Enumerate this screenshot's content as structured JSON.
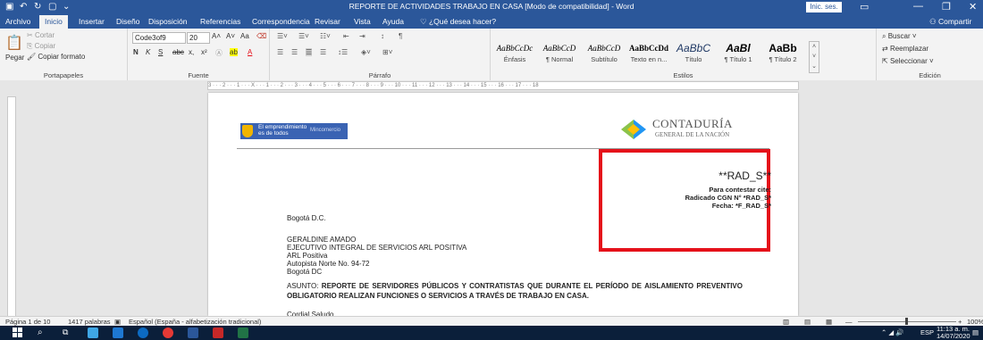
{
  "window": {
    "title": "REPORTE DE ACTIVIDADES TRABAJO EN CASA [Modo de compatibilidad] - Word",
    "sign_in": "Inic. ses."
  },
  "tabs": {
    "items": [
      "Archivo",
      "Inicio",
      "Insertar",
      "Diseño",
      "Disposición",
      "Referencias",
      "Correspondencia",
      "Revisar",
      "Vista",
      "Ayuda"
    ],
    "tell_me": "¿Qué desea hacer?",
    "share": "Compartir"
  },
  "ribbon": {
    "clipboard": {
      "label": "Portapapeles",
      "paste": "Pegar",
      "cut": "Cortar",
      "copy": "Copiar",
      "format_painter": "Copiar formato"
    },
    "font": {
      "label": "Fuente",
      "font_name": "Code3of9",
      "font_size": "20",
      "bold": "N",
      "italic": "K",
      "underline": "S",
      "strike": "abc",
      "sub": "x,",
      "sup": "x²"
    },
    "paragraph": {
      "label": "Párrafo"
    },
    "styles": {
      "label": "Estilos",
      "items": [
        {
          "preview": "AaBbCcDc",
          "name": "Énfasis"
        },
        {
          "preview": "AaBbCcD",
          "name": "¶ Normal"
        },
        {
          "preview": "AaBbCcD",
          "name": "Subtítulo"
        },
        {
          "preview": "AaBbCcDd",
          "name": "Texto en n..."
        },
        {
          "preview": "AaBbC",
          "name": "Título"
        },
        {
          "preview": "AaBl",
          "name": "¶ Título 1"
        },
        {
          "preview": "AaBb",
          "name": "¶ Título 2"
        }
      ]
    },
    "editing": {
      "label": "Edición",
      "find": "Buscar",
      "replace": "Reemplazar",
      "select": "Seleccionar"
    }
  },
  "ruler": {
    "text": "3 · · · 2 · · · 1 · · · X · · · 1 · · · 2 · · · 3 · · · 4 · · · 5 · · · 6 · · · 7 · · · 8 · · · 9 · · · 10 · · · 11 · · · 12 · · · 13 · · · 14 · · · 15 · · · 16 · · · 17 · · · 18"
  },
  "document": {
    "logo_left_line1": "El emprendimiento",
    "logo_left_line2": "es de todos",
    "logo_left_tag": "Mincomercio",
    "logo_right_name": "CONTADURÍA",
    "logo_right_sub": "GENERAL DE LA NACIÓN",
    "rad_main": "**RAD_S**",
    "rad_line1": "Para contestar cite:",
    "rad_line2": "Radicado CGN N° *RAD_S*",
    "rad_line3": "Fecha: *F_RAD_S*",
    "city": "Bogotá D.C.",
    "recipient": [
      "GERALDINE AMADO",
      "EJECUTIVO INTEGRAL DE SERVICIOS ARL POSITIVA",
      "ARL Positiva",
      "Autopista Norte No. 94-72",
      "Bogotá DC"
    ],
    "asunto_prefix": "ASUNTO: ",
    "asunto_bold": "REPORTE DE SERVIDORES PÚBLICOS Y CONTRATISTAS QUE DURANTE EL PERÍODO DE AISLAMIENTO PREVENTIVO OBLIGATORIO REALIZAN FUNCIONES O SERVICIOS A TRAVÉS DE TRABAJO EN CASA.",
    "greeting": "Cordial Saludo"
  },
  "status": {
    "page": "Página 1 de 10",
    "words": "1417 palabras",
    "language": "Español (España - alfabetización tradicional)",
    "zoom": "100%"
  },
  "taskbar": {
    "time": "11:13 a. m.",
    "date": "14/07/2020",
    "lang": "ESP"
  },
  "colors": {
    "word_blue": "#2b579a",
    "highlight_red": "#e5101a"
  }
}
